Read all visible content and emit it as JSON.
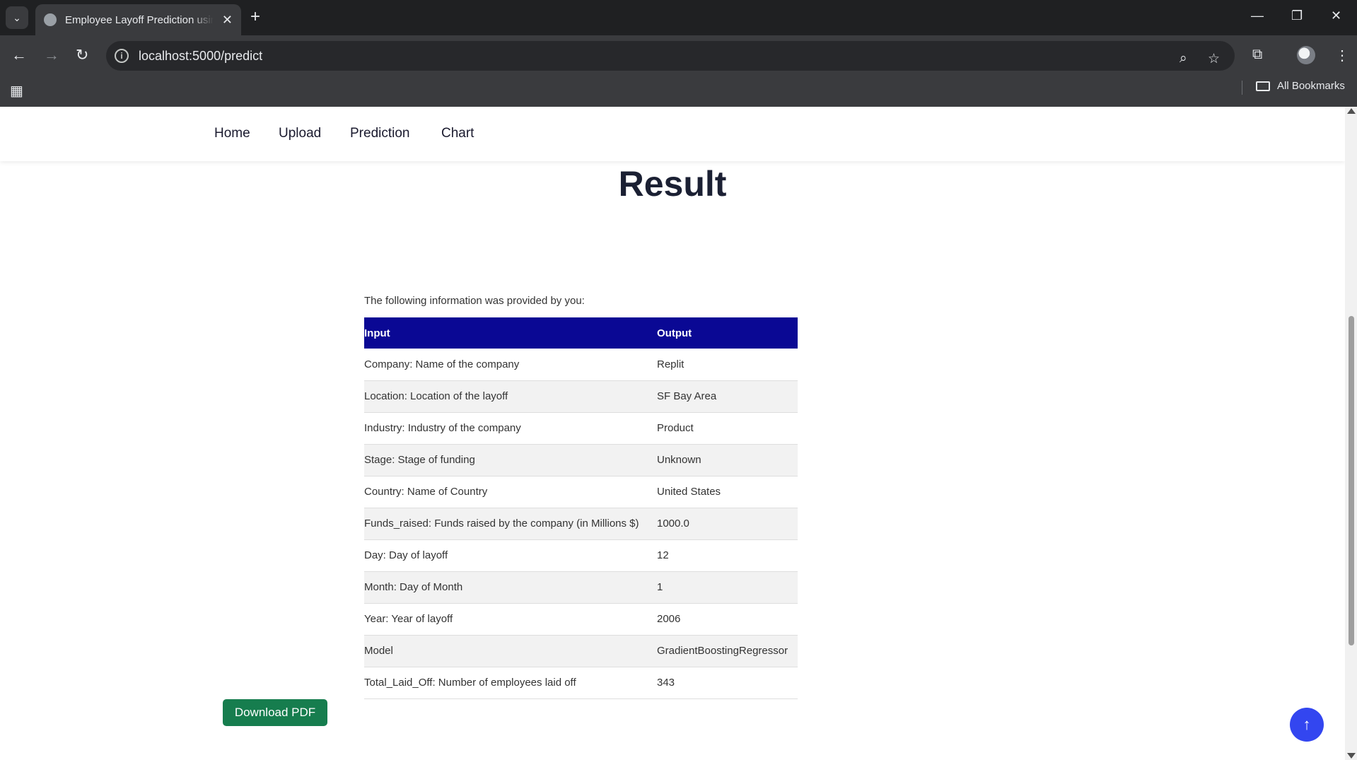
{
  "browser": {
    "tab_title": "Employee Layoff Prediction using",
    "url": "localhost:5000/predict",
    "bookmarks_label": "All Bookmarks"
  },
  "nav": {
    "items": [
      {
        "label": "Home"
      },
      {
        "label": "Upload"
      },
      {
        "label": "Prediction"
      },
      {
        "label": "Chart"
      }
    ]
  },
  "result": {
    "title": "Result",
    "intro": "The following information was provided by you:",
    "headers": {
      "input": "Input",
      "output": "Output"
    },
    "rows": [
      {
        "input": "Company: Name of the company",
        "output": "Replit"
      },
      {
        "input": "Location: Location of the layoff",
        "output": "SF Bay Area"
      },
      {
        "input": "Industry: Industry of the company",
        "output": "Product"
      },
      {
        "input": "Stage: Stage of funding",
        "output": "Unknown"
      },
      {
        "input": "Country: Name of Country",
        "output": "United States"
      },
      {
        "input": "Funds_raised: Funds raised by the company (in Millions $)",
        "output": "1000.0"
      },
      {
        "input": "Day: Day of layoff",
        "output": "12"
      },
      {
        "input": "Month: Day of Month",
        "output": "1"
      },
      {
        "input": "Year: Year of layoff",
        "output": "2006"
      },
      {
        "input": "Model",
        "output": "GradientBoostingRegressor"
      },
      {
        "input": "Total_Laid_Off: Number of employees laid off",
        "output": "343"
      }
    ]
  },
  "actions": {
    "download_pdf": "Download PDF"
  },
  "colors": {
    "table_header": "#0a0894",
    "download_button": "#167d4e",
    "back_to_top": "#3346f0"
  }
}
